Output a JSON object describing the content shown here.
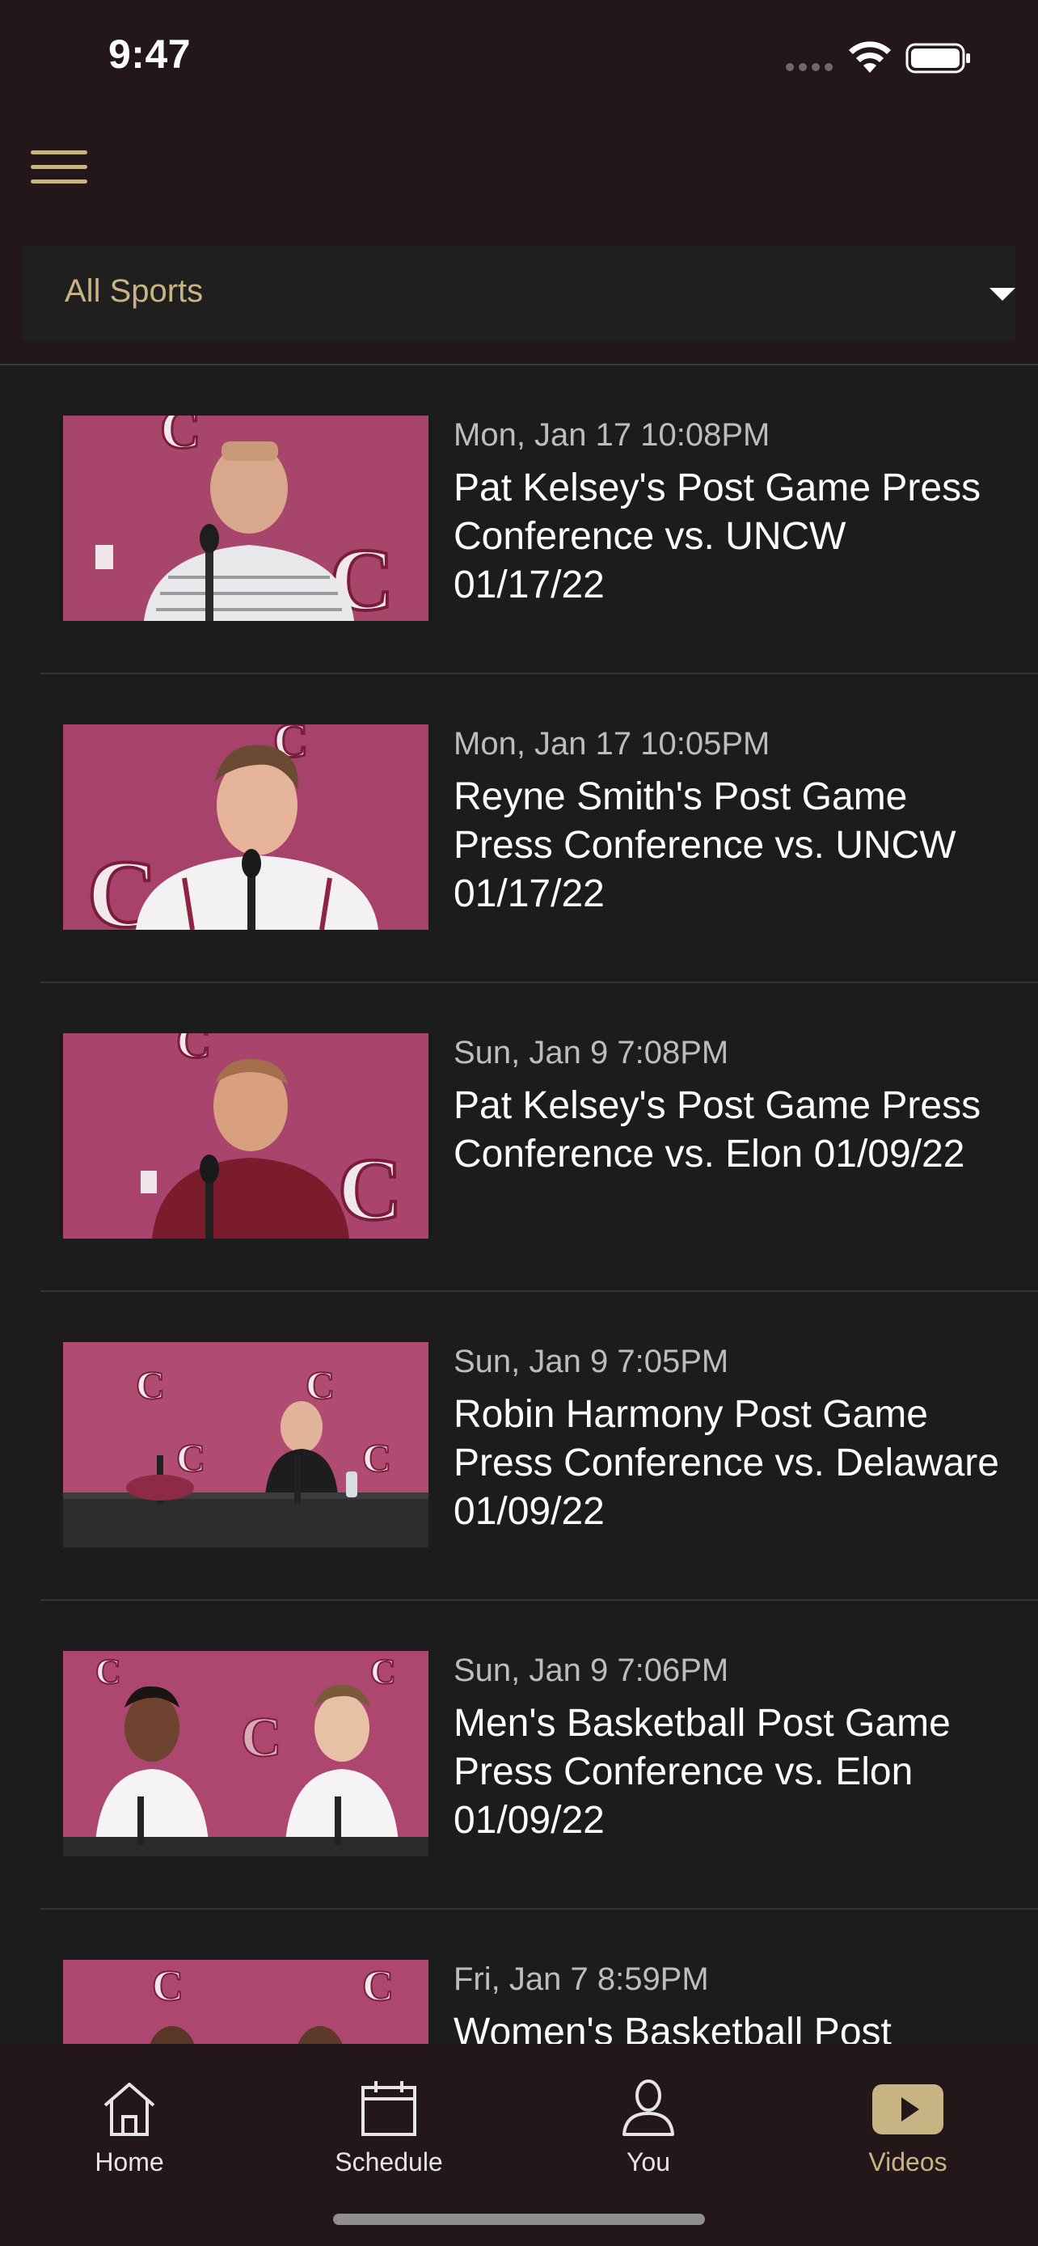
{
  "status_bar": {
    "time": "9:47"
  },
  "filter": {
    "selected": "All Sports"
  },
  "videos": [
    {
      "date": "Mon, Jan 17 10:08PM",
      "title": "Pat Kelsey's Post Game Press Conference vs. UNCW 01/17/22"
    },
    {
      "date": "Mon, Jan 17 10:05PM",
      "title": "Reyne Smith's Post Game Press Conference vs. UNCW 01/17/22"
    },
    {
      "date": "Sun, Jan 9 7:08PM",
      "title": "Pat Kelsey's Post Game Press Conference vs. Elon 01/09/22"
    },
    {
      "date": "Sun, Jan 9 7:05PM",
      "title": "Robin Harmony Post Game Press Conference vs. Delaware 01/09/22"
    },
    {
      "date": "Sun, Jan 9 7:06PM",
      "title": "Men's Basketball Post Game Press Conference vs. Elon 01/09/22"
    },
    {
      "date": "Fri, Jan 7 8:59PM",
      "title": "Women's Basketball Post"
    }
  ],
  "tabs": [
    {
      "label": "Home",
      "icon": "home-icon"
    },
    {
      "label": "Schedule",
      "icon": "calendar-icon"
    },
    {
      "label": "You",
      "icon": "person-icon"
    },
    {
      "label": "Videos",
      "icon": "play-icon",
      "active": true
    }
  ],
  "colors": {
    "accent": "#c8b483",
    "header_bg": "#231719",
    "list_bg": "#1c1c1e",
    "thumbnail_backdrop": "#a43f67"
  }
}
